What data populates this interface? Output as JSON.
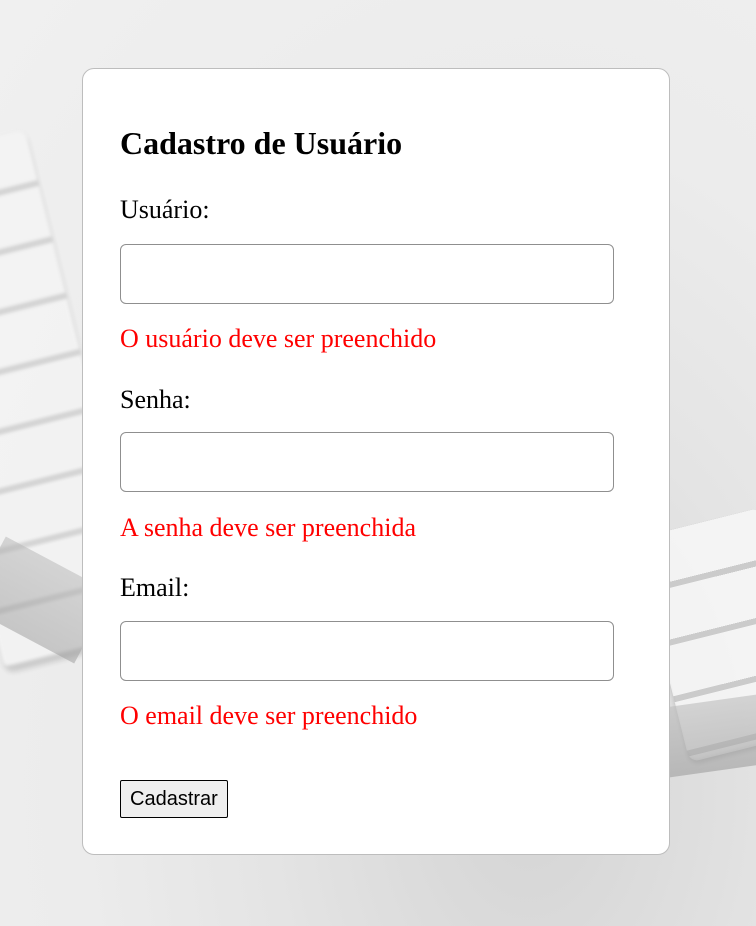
{
  "form": {
    "title": "Cadastro de Usuário",
    "fields": [
      {
        "label": "Usuário:",
        "value": "",
        "error": "O usuário deve ser preenchido"
      },
      {
        "label": "Senha:",
        "value": "",
        "error": "A senha deve ser preenchida"
      },
      {
        "label": "Email:",
        "value": "",
        "error": "O email deve ser preenchido"
      }
    ],
    "submit_label": "Cadastrar"
  },
  "colors": {
    "error": "#ff0000",
    "card_background": "#ffffff",
    "page_background": "#e8e8e8"
  }
}
